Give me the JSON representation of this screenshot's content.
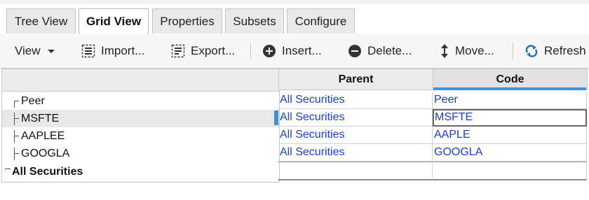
{
  "tabs": [
    {
      "label": "Tree View",
      "active": false
    },
    {
      "label": "Grid View",
      "active": true
    },
    {
      "label": "Properties",
      "active": false
    },
    {
      "label": "Subsets",
      "active": false
    },
    {
      "label": "Configure",
      "active": false
    }
  ],
  "toolbar": {
    "view": "View",
    "import": "Import...",
    "export": "Export...",
    "insert": "Insert...",
    "delete": "Delete...",
    "move": "Move...",
    "refresh": "Refresh"
  },
  "grid": {
    "columns": {
      "parent": "Parent",
      "code": "Code"
    },
    "rows": [
      {
        "label": "Peer",
        "parent": "All Securities",
        "code": "Peer"
      },
      {
        "label": "MSFTE",
        "parent": "All Securities",
        "code": "MSFTE",
        "selected": true
      },
      {
        "label": "AAPLEE",
        "parent": "All Securities",
        "code": "AAPLE"
      },
      {
        "label": "GOOGLA",
        "parent": "All Securities",
        "code": "GOOGLA"
      }
    ],
    "root_label": "All Securities"
  },
  "colors": {
    "link": "#1a3fd6",
    "accent": "#2f9be0",
    "selected_row": "#e8e8e8"
  }
}
